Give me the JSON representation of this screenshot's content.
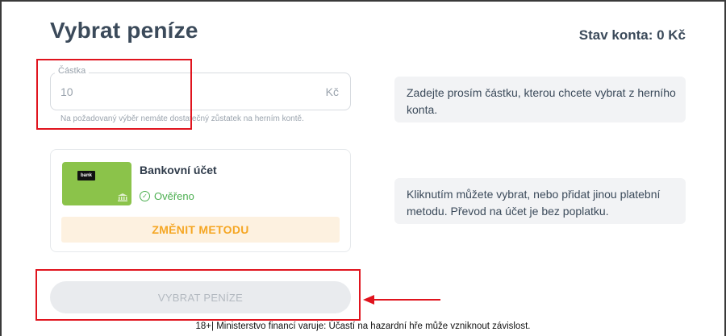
{
  "header": {
    "title": "Vybrat peníze",
    "balance": "Stav konta: 0 Kč"
  },
  "amount": {
    "label": "Částka",
    "value": "10",
    "currency": "Kč",
    "error": "Na požadovaný výběr nemáte dostatečný zůstatek na herním kontě."
  },
  "hints": [
    "Zadejte prosím částku, kterou chcete vybrat z herního konta.",
    "Kliknutím můžete vybrat, nebo přidat jinou platební metodu. Převod na účet je bez poplatku."
  ],
  "method": {
    "name": "Bankovní účet",
    "logo_text": "bank",
    "status": "Ověřeno",
    "change_label": "ZMĚNIT METODU",
    "card_color": "#8bc34a"
  },
  "withdraw": {
    "label": "VYBRAT PENÍZE"
  },
  "footer": {
    "disclaimer": "18+| Ministerstvo financí varuje: Účastí na hazardní hře může vzniknout závislost."
  },
  "colors": {
    "accent": "#f5a623",
    "success": "#4caf50",
    "annotation": "#e0141e"
  }
}
